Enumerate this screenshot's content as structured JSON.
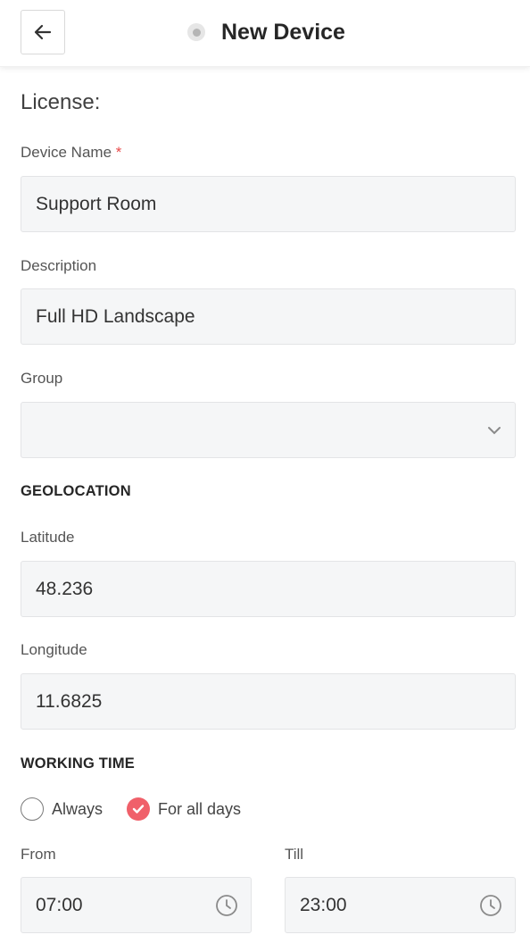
{
  "header": {
    "title": "New Device"
  },
  "form": {
    "license_label": "License:",
    "device_name": {
      "label": "Device Name",
      "required_mark": "*",
      "value": "Support Room"
    },
    "description": {
      "label": "Description",
      "value": "Full HD Landscape"
    },
    "group": {
      "label": "Group",
      "value": ""
    },
    "geolocation": {
      "section_title": "GEOLOCATION",
      "latitude": {
        "label": "Latitude",
        "value": "48.236"
      },
      "longitude": {
        "label": "Longitude",
        "value": "11.6825"
      }
    },
    "working_time": {
      "section_title": "WORKING TIME",
      "options": [
        {
          "label": "Always",
          "checked": false
        },
        {
          "label": "For all days",
          "checked": true
        }
      ],
      "from": {
        "label": "From",
        "value": "07:00"
      },
      "till": {
        "label": "Till",
        "value": "23:00"
      }
    }
  },
  "colors": {
    "accent": "#f0606a",
    "field_bg": "#f5f6f7",
    "required": "#e84b4b"
  },
  "icons": [
    "arrow-left-icon",
    "status-dot-icon",
    "chevron-down-icon",
    "clock-icon",
    "check-icon"
  ]
}
